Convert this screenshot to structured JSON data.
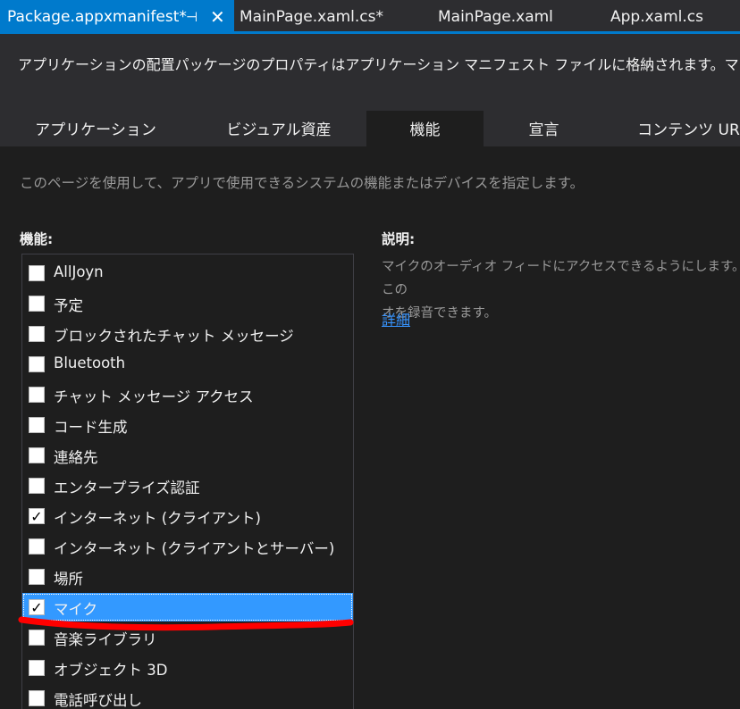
{
  "doc_tabs": [
    {
      "label": "Package.appxmanifest*",
      "active": true,
      "pin": "⊣",
      "close": "✕"
    },
    {
      "label": "MainPage.xaml.cs*"
    },
    {
      "label": "MainPage.xaml"
    },
    {
      "label": "App.xaml.cs"
    }
  ],
  "header": {
    "description": "アプリケーションの配置パッケージのプロパティはアプリケーション マニフェスト ファイルに格納されます。マニフェスト デザイナ"
  },
  "section_tabs": [
    "アプリケーション",
    "ビジュアル資産",
    "機能",
    "宣言",
    "コンテンツ URI"
  ],
  "selected_section": "機能",
  "instruction": "このページを使用して、アプリで使用できるシステムの機能またはデバイスを指定します。",
  "capabilities_heading": "機能:",
  "capabilities": [
    {
      "label": "AllJoyn",
      "checked": false
    },
    {
      "label": "予定",
      "checked": false
    },
    {
      "label": "ブロックされたチャット メッセージ",
      "checked": false
    },
    {
      "label": "Bluetooth",
      "checked": false
    },
    {
      "label": "チャット メッセージ アクセス",
      "checked": false
    },
    {
      "label": "コード生成",
      "checked": false
    },
    {
      "label": "連絡先",
      "checked": false
    },
    {
      "label": "エンタープライズ認証",
      "checked": false
    },
    {
      "label": "インターネット (クライアント)",
      "checked": true
    },
    {
      "label": "インターネット (クライアントとサーバー)",
      "checked": false
    },
    {
      "label": "場所",
      "checked": false
    },
    {
      "label": "マイク",
      "checked": true,
      "selected": true
    },
    {
      "label": "音楽ライブラリ",
      "checked": false
    },
    {
      "label": "オブジェクト 3D",
      "checked": false
    },
    {
      "label": "電話呼び出し",
      "checked": false
    }
  ],
  "check_glyph": "✓",
  "description_heading": "説明:",
  "description_line1": "マイクのオーディオ フィードにアクセスできるようにします。この",
  "description_line2": "オを録音できます。",
  "more_link": "詳細",
  "colors": {
    "accent": "#007acc",
    "selection": "#3399ff",
    "link": "#3794ff",
    "annotation": "#ff0000"
  }
}
